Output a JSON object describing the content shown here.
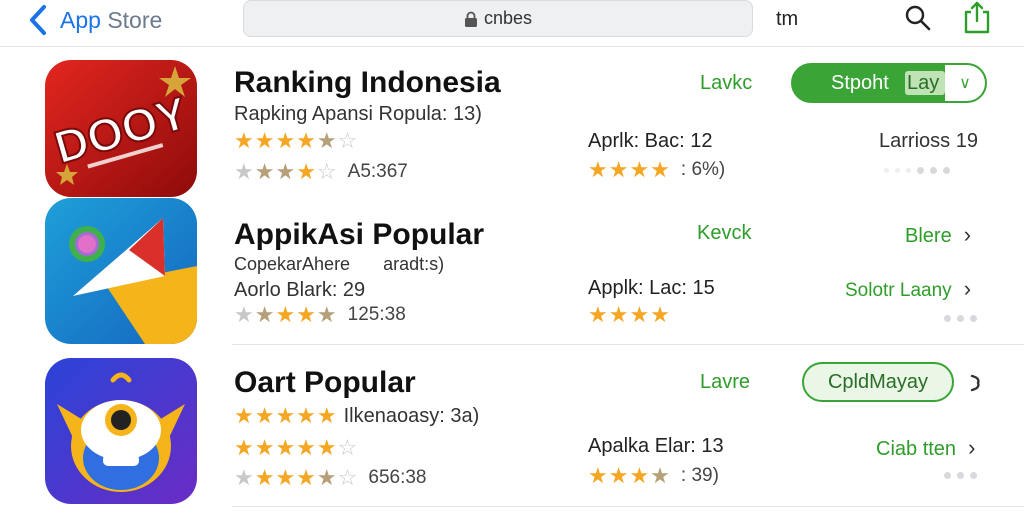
{
  "nav": {
    "back_label_app": "App",
    "back_label_store": "Store",
    "url_text": "cnbes",
    "right_text": "tm",
    "icons": [
      "chevron-left-icon",
      "lock-icon",
      "search-icon",
      "share-icon"
    ]
  },
  "apps": [
    {
      "title": "Ranking Indonesia",
      "subtitle": "Rapking Apansi Ropula: 13)",
      "rating_count": "A5:367",
      "mid_label": "Aprlk: Bac: 12",
      "mid_rating": ": 6%)",
      "status_label": "Lavkc",
      "button_label": "Stpoht",
      "button_label2": "Lay",
      "right_label": "Larrioss 19",
      "icon_text": "DOOY"
    },
    {
      "title": "AppikAsi Popular",
      "subtitle_a": "CopekarAhere",
      "subtitle_b": "aradt:s)",
      "subtitle2": "Aorlo Blark: 29",
      "rating_count": "125:38",
      "mid_label": "Applk: Lac: 15",
      "status_label": "Kevck",
      "right_label": "Blere",
      "right_label2": "Solotr Laany"
    },
    {
      "title": "Oart Popular",
      "subtitle": "Ilkenaoasy: 3a)",
      "rating_count": "656:38",
      "mid_label": "Apalka Elar: 13",
      "mid_rating": ": 39)",
      "status_label": "Lavre",
      "button_label": "CpldMayay",
      "right_label": "Ciab tten"
    }
  ],
  "colors": {
    "accent_blue": "#1a73e8",
    "accent_green": "#3aa536",
    "star": "#f5a623"
  }
}
